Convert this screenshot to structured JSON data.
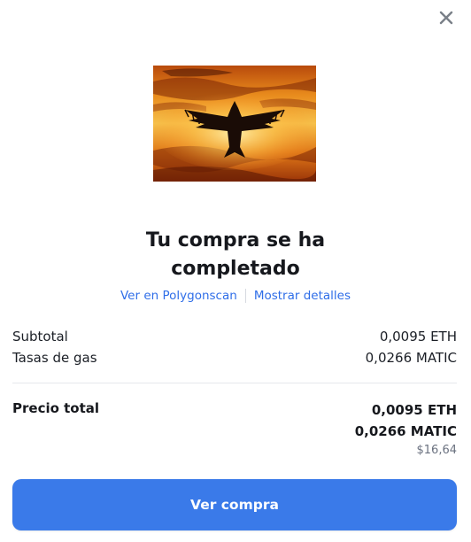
{
  "dialog": {
    "close_icon": "close-icon",
    "image_alt": "Bird silhouette over fiery sunset clouds",
    "title_line1": "Tu compra se ha",
    "title_line2": "completado",
    "links": {
      "polygonscan": "Ver en Polygonscan",
      "details": "Mostrar detalles"
    },
    "summary": {
      "subtotal_label": "Subtotal",
      "subtotal_value": "0,0095 ETH",
      "gas_label": "Tasas de gas",
      "gas_value": "0,0266 MATIC"
    },
    "total": {
      "label": "Precio total",
      "eth": "0,0095 ETH",
      "matic": "0,0266 MATIC",
      "usd": "$16,64"
    },
    "cta_label": "Ver compra"
  },
  "colors": {
    "accent": "#3a7ae9",
    "link": "#2f6ee8",
    "text": "#16181d",
    "muted": "#6b7280"
  }
}
